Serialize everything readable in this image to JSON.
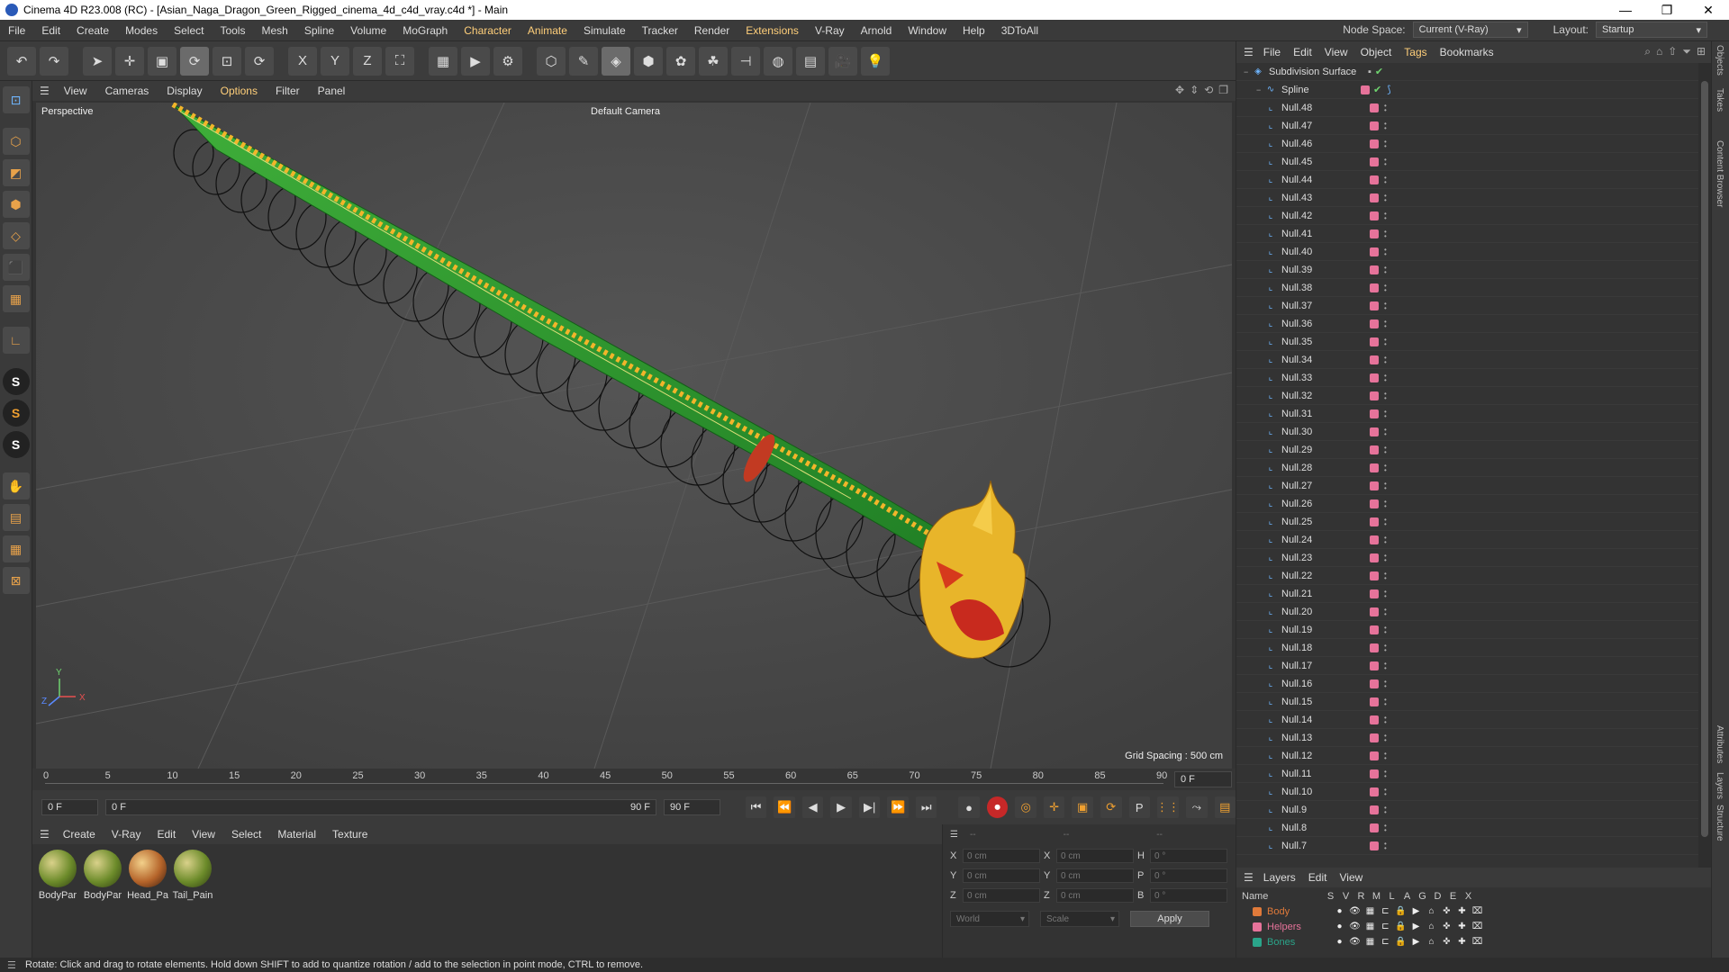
{
  "window": {
    "title": "Cinema 4D R23.008 (RC) - [Asian_Naga_Dragon_Green_Rigged_cinema_4d_c4d_vray.c4d *] - Main",
    "controls": [
      "—",
      "❐",
      "✕"
    ]
  },
  "menubar": {
    "items": [
      "File",
      "Edit",
      "Create",
      "Modes",
      "Select",
      "Tools",
      "Mesh",
      "Spline",
      "Volume",
      "MoGraph",
      "Character",
      "Animate",
      "Simulate",
      "Tracker",
      "Render",
      "Extensions",
      "V-Ray",
      "Arnold",
      "Window",
      "Help",
      "3DToAll"
    ],
    "node_space_label": "Node Space:",
    "node_space_value": "Current (V-Ray)",
    "layout_label": "Layout:",
    "layout_value": "Startup"
  },
  "toolbar": {
    "icons": [
      "undo-icon",
      "redo-icon",
      "select-icon",
      "move-icon",
      "scale-icon",
      "rotate-icon",
      "recent-tool-icon",
      "rotate-alt-icon",
      "x-axis-icon",
      "y-axis-icon",
      "z-axis-icon",
      "coordinate-system-icon",
      "render-view-icon",
      "render-picture-viewer-icon",
      "render-settings-icon",
      "cube-icon",
      "pen-icon",
      "subdivision-icon",
      "extrude-icon",
      "cloner-icon",
      "mograph-icon",
      "deformer-icon",
      "field-icon",
      "floor-icon",
      "camera-icon",
      "light-icon"
    ],
    "glyphs": [
      "↶",
      "↷",
      "➤",
      "✛",
      "▣",
      "⟳",
      "⊡",
      "⟳",
      "X",
      "Y",
      "Z",
      "⛶",
      "▦",
      "▶",
      "⚙",
      "⬡",
      "✎",
      "◈",
      "⬢",
      "✿",
      "☘",
      "⊣",
      "◍",
      "▤",
      "🎥",
      "💡"
    ]
  },
  "lefttools": {
    "icons": [
      "make-editable-icon",
      "model-mode-icon",
      "texture-mode-icon",
      "points-mode-icon",
      "edges-mode-icon",
      "polygons-mode-icon",
      "uv-mode-icon",
      "axis-icon",
      "snap-icon",
      "soft-selection-icon",
      "sculpt-icon",
      "weight-icon",
      "workplane-icon",
      "grid-icon",
      "lock-icon"
    ]
  },
  "viewport": {
    "menu": [
      "View",
      "Cameras",
      "Display",
      "Options",
      "Filter",
      "Panel"
    ],
    "label": "Perspective",
    "camera": "Default Camera",
    "grid_spacing": "Grid Spacing : 500 cm",
    "axis_x": "X",
    "axis_y": "Y",
    "axis_z": "Z"
  },
  "timeline": {
    "ticks": [
      "0",
      "5",
      "10",
      "15",
      "20",
      "25",
      "30",
      "35",
      "40",
      "45",
      "50",
      "55",
      "60",
      "65",
      "70",
      "75",
      "80",
      "85",
      "90"
    ],
    "current_frame": "0 F",
    "start_field": "0 F",
    "range_start": "0 F",
    "range_end": "90 F",
    "end_field": "90 F"
  },
  "materials": {
    "menu": [
      "Create",
      "V-Ray",
      "Edit",
      "View",
      "Select",
      "Material",
      "Texture"
    ],
    "items": [
      {
        "label": "BodyPar",
        "kind": "body"
      },
      {
        "label": "BodyPar",
        "kind": "body"
      },
      {
        "label": "Head_Pa",
        "kind": "head"
      },
      {
        "label": "Tail_Pain",
        "kind": "body"
      }
    ]
  },
  "coords": {
    "headers": [
      "--",
      "--",
      "--"
    ],
    "rows": [
      {
        "a": "X",
        "v1": "0 cm",
        "b": "X",
        "v2": "0 cm",
        "c": "H",
        "v3": "0 °"
      },
      {
        "a": "Y",
        "v1": "0 cm",
        "b": "Y",
        "v2": "0 cm",
        "c": "P",
        "v3": "0 °"
      },
      {
        "a": "Z",
        "v1": "0 cm",
        "b": "Z",
        "v2": "0 cm",
        "c": "B",
        "v3": "0 °"
      }
    ],
    "mode1": "World",
    "mode2": "Scale",
    "apply": "Apply"
  },
  "objects": {
    "menu": [
      "File",
      "Edit",
      "View",
      "Object",
      "Tags",
      "Bookmarks"
    ],
    "root": "Subdivision Surface",
    "spline": "Spline",
    "items": [
      "Null.48",
      "Null.47",
      "Null.46",
      "Null.45",
      "Null.44",
      "Null.43",
      "Null.42",
      "Null.41",
      "Null.40",
      "Null.39",
      "Null.38",
      "Null.37",
      "Null.36",
      "Null.35",
      "Null.34",
      "Null.33",
      "Null.32",
      "Null.31",
      "Null.30",
      "Null.29",
      "Null.28",
      "Null.27",
      "Null.26",
      "Null.25",
      "Null.24",
      "Null.23",
      "Null.22",
      "Null.21",
      "Null.20",
      "Null.19",
      "Null.18",
      "Null.17",
      "Null.16",
      "Null.15",
      "Null.14",
      "Null.13",
      "Null.12",
      "Null.11",
      "Null.10",
      "Null.9",
      "Null.8",
      "Null.7"
    ]
  },
  "vtabs": [
    "Objects",
    "Takes",
    "Content Browser",
    "Attributes",
    "Layers",
    "Structure"
  ],
  "layers": {
    "menu": [
      "Layers",
      "Edit",
      "View"
    ],
    "columns": [
      "Name",
      "S",
      "V",
      "R",
      "M",
      "L",
      "A",
      "G",
      "D",
      "E",
      "X"
    ],
    "items": [
      {
        "name": "Body",
        "color": "#e07a3a"
      },
      {
        "name": "Helpers",
        "color": "#e6739a"
      },
      {
        "name": "Bones",
        "color": "#2aa58a"
      }
    ]
  },
  "status": "Rotate: Click and drag to rotate elements. Hold down SHIFT to add to quantize rotation / add to the selection in point mode, CTRL to remove."
}
